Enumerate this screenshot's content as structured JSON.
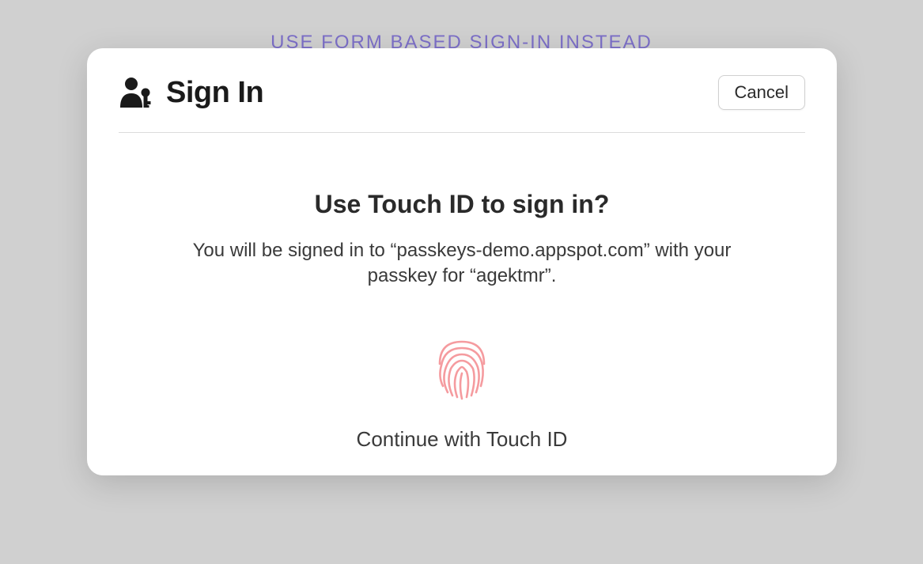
{
  "background": {
    "link_text": "USE FORM BASED SIGN-IN INSTEAD"
  },
  "dialog": {
    "title": "Sign In",
    "cancel_label": "Cancel",
    "prompt_heading": "Use Touch ID to sign in?",
    "prompt_description": "You will be signed in to “passkeys-demo.appspot.com” with your passkey for “agektmr”.",
    "continue_label": "Continue with Touch ID"
  },
  "colors": {
    "link": "#7c6fc8",
    "fingerprint": "#f59b9f"
  }
}
